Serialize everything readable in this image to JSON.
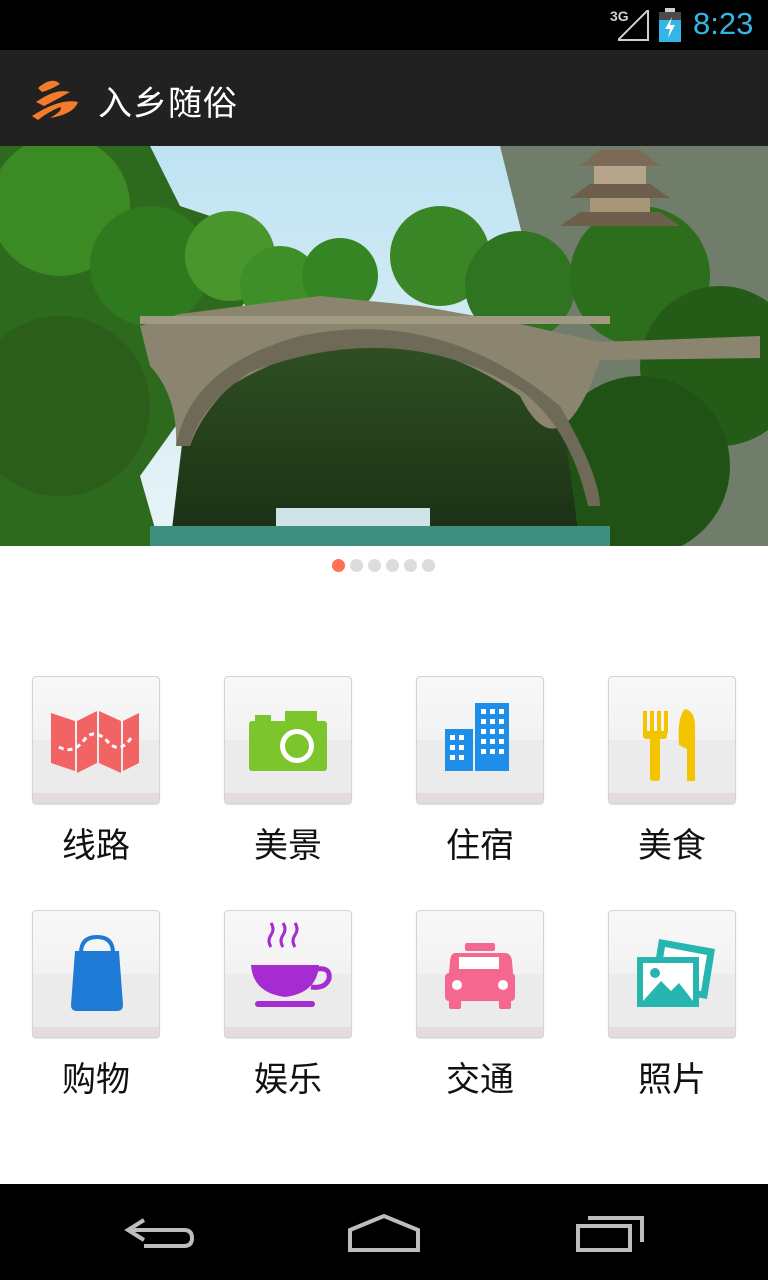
{
  "status_bar": {
    "network": "3G",
    "time": "8:23",
    "time_color": "#33b5e5"
  },
  "app": {
    "title": "入乡随俗",
    "logo_color": "#f47b2a"
  },
  "banner": {
    "image": "stone-arch-bridge-landscape-photo",
    "total_slides": 6,
    "active_slide": 1,
    "active_dot_color": "#ff7054",
    "inactive_dot_color": "#dcdcdc"
  },
  "categories": [
    {
      "label": "线路",
      "icon": "map-icon",
      "color": "#f26363"
    },
    {
      "label": "美景",
      "icon": "camera-icon",
      "color": "#7cc52c"
    },
    {
      "label": "住宿",
      "icon": "building-icon",
      "color": "#1e8ee8"
    },
    {
      "label": "美食",
      "icon": "fork-knife-icon",
      "color": "#f5c400"
    },
    {
      "label": "购物",
      "icon": "shopping-bag-icon",
      "color": "#1e7ad4"
    },
    {
      "label": "娱乐",
      "icon": "coffee-cup-icon",
      "color": "#a62bd1"
    },
    {
      "label": "交通",
      "icon": "taxi-icon",
      "color": "#f4678f"
    },
    {
      "label": "照片",
      "icon": "photos-icon",
      "color": "#27b5b0"
    }
  ],
  "nav_bar": {
    "buttons": [
      "back",
      "home",
      "recent-apps"
    ]
  }
}
